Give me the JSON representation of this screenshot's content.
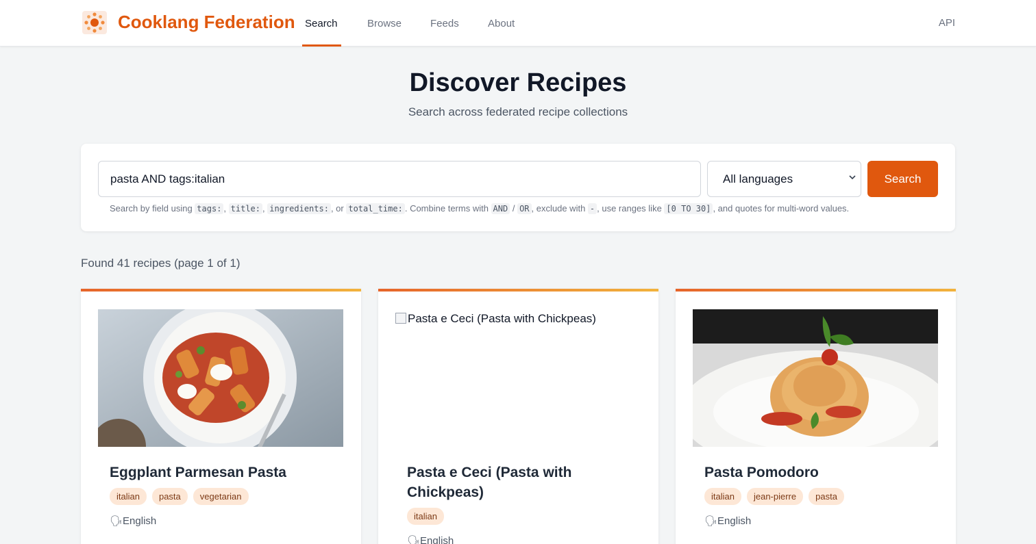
{
  "header": {
    "brand": "Cooklang Federation",
    "nav": [
      "Search",
      "Browse",
      "Feeds",
      "About"
    ],
    "api": "API",
    "colors": {
      "accent": "#e0580e"
    }
  },
  "hero": {
    "title": "Discover Recipes",
    "subtitle": "Search across federated recipe collections"
  },
  "search": {
    "query": "pasta AND tags:italian",
    "language": "All languages",
    "button": "Search",
    "help": {
      "t1": "Search by field using ",
      "c1": "tags:",
      "t2": ", ",
      "c2": "title:",
      "t3": ", ",
      "c3": "ingredients:",
      "t4": ", or ",
      "c4": "total_time:",
      "t5": ". Combine terms with ",
      "c5": "AND",
      "t6": " / ",
      "c6": "OR",
      "t7": ", exclude with ",
      "c7": "-",
      "t8": ", use ranges like ",
      "c8": "[0 TO 30]",
      "t9": ", and quotes for multi-word values."
    }
  },
  "results": {
    "count_text": "Found 41 recipes (page 1 of 1)",
    "cards": [
      {
        "title": "Eggplant Parmesan Pasta",
        "tags": [
          "italian",
          "pasta",
          "vegetarian"
        ],
        "language": "English",
        "lang_icon": "speaking-head-icon"
      },
      {
        "title": "Pasta e Ceci (Pasta with Chickpeas)",
        "image_alt": "Pasta e Ceci (Pasta with Chickpeas)",
        "tags": [
          "italian"
        ],
        "language": "English",
        "lang_icon": "speaking-head-icon"
      },
      {
        "title": "Pasta Pomodoro",
        "tags": [
          "italian",
          "jean-pierre",
          "pasta"
        ],
        "language": "English",
        "lang_icon": "speaking-head-icon"
      }
    ]
  }
}
